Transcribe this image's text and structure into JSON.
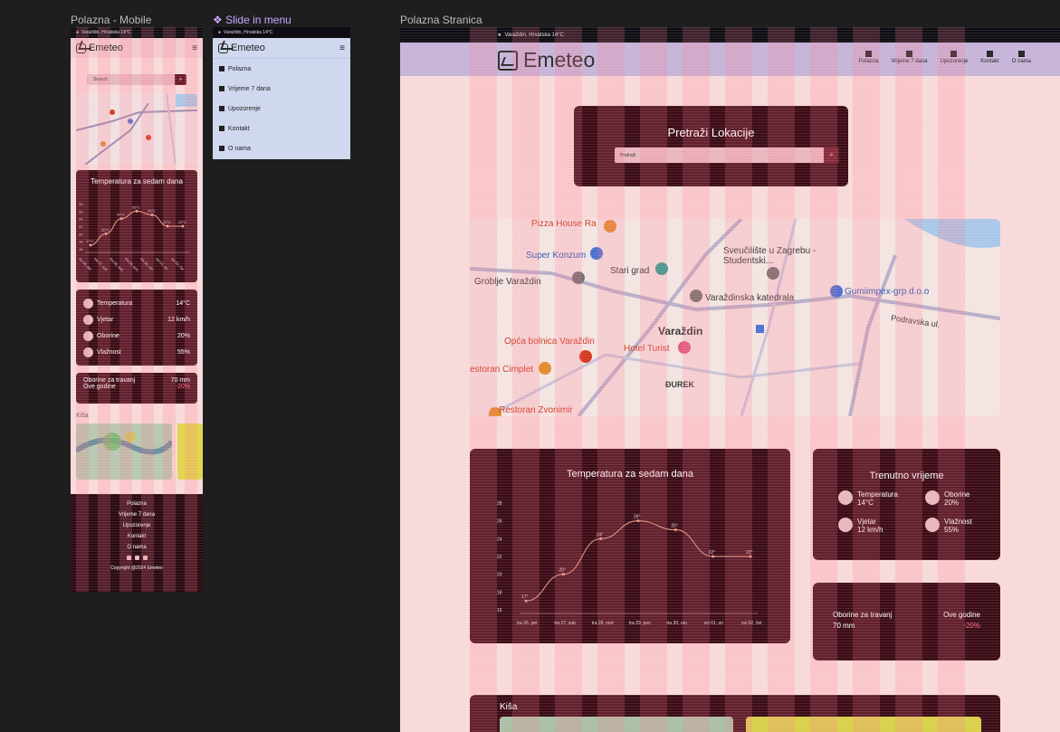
{
  "frames": {
    "mobile": "Polazna - Mobile",
    "slide": "❖ Slide in menu",
    "desktop": "Polazna Stranica"
  },
  "location_bar": "Varaždin, Hrvatska 14°C",
  "brand": "Emeteo",
  "search": {
    "placeholder": "Search",
    "desktop_title": "Pretraži Lokacije",
    "desktop_placeholder": "Pretraži"
  },
  "nav": [
    "Polazna",
    "Vrijeme 7 dana",
    "Upozorenje",
    "Kontakt",
    "O nama"
  ],
  "map_labels": [
    "Pizza House Ra",
    "Super Konzum",
    "Stari grad",
    "Sveučilište u Zagrebu - Studentski...",
    "Groblje Varaždin",
    "Varaždinska katedrala",
    "Gumiimpex-grp d.o.o",
    "Podravska ul.",
    "Varaždin",
    "Opća bolnica Varaždin",
    "Hotel Turist",
    "estoran Cimplet",
    "ĐUREK",
    "Restoran Zvonimir"
  ],
  "chart": {
    "title": "Temperatura za sedam dana",
    "y_ticks": [
      16,
      18,
      20,
      22,
      24,
      26,
      28
    ],
    "categories": [
      "tra 26, pet",
      "tra 27, sub",
      "tra 28, ned",
      "tra 29, pon",
      "tra 30, uto",
      "svi 01, sri",
      "svi 02, čet"
    ],
    "point_labels": [
      "17°",
      "20°",
      "24°",
      "26°",
      "25°",
      "22°",
      "22°"
    ]
  },
  "mobile_chart": {
    "title": "Temperatura za sedam dana",
    "point_labels": [
      "17°C",
      "20°C",
      "24°C",
      "26°C",
      "25°C",
      "22°C",
      "22°C"
    ]
  },
  "chart_data": {
    "type": "line",
    "title": "Temperatura za sedam dana",
    "categories": [
      "tra 26, pet",
      "tra 27, sub",
      "tra 28, ned",
      "tra 29, pon",
      "tra 30, uto",
      "svi 01, sri",
      "svi 02, čet"
    ],
    "values": [
      17,
      20,
      24,
      26,
      25,
      22,
      22
    ],
    "ylim": [
      16,
      28
    ],
    "xlabel": "",
    "ylabel": ""
  },
  "current": {
    "title": "Trenutno vrijeme",
    "temp_label": "Temperatura",
    "temp_value": "14°C",
    "wind_label": "Vjetar",
    "wind_value": "12 km/h",
    "rain_label": "Oborine",
    "rain_value": "20%",
    "hum_label": "Vlažnost",
    "hum_value": "55%"
  },
  "rain_summary": {
    "month_label": "Oborine za travanj",
    "month_value": "70 mm",
    "year_label": "Ove godine",
    "year_value": "-20%"
  },
  "kisa": "Kiša",
  "copyright": "Copyright @2024 Emeteo",
  "colors": {
    "maroon": "#3b0b16",
    "pink_bg": "#f8d9d9",
    "nav_purple": "#c6b3d7",
    "accent_pink": "#ff6b8a"
  }
}
